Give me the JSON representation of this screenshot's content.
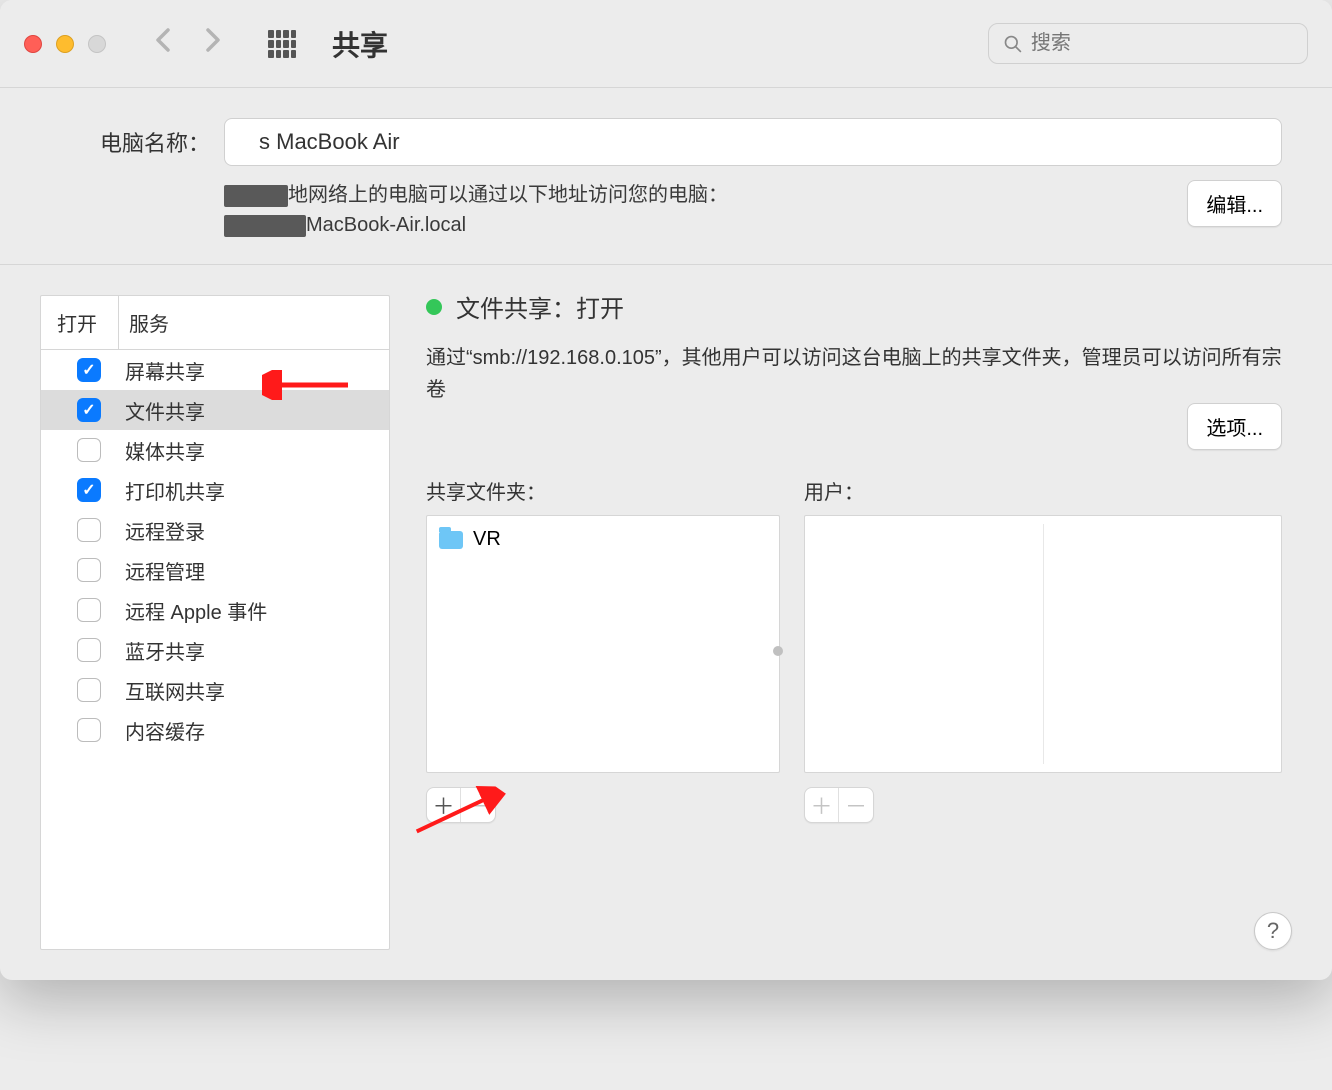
{
  "titlebar": {
    "title": "共享",
    "search_placeholder": "搜索"
  },
  "header": {
    "computer_name_label": "电脑名称：",
    "computer_name_value": "s MacBook Air",
    "desc_line1": "地网络上的电脑可以通过以下地址访问您的电脑：",
    "desc_line2": "MacBook-Air.local",
    "edit_button": "编辑..."
  },
  "services": {
    "col_on": "打开",
    "col_service": "服务",
    "items": [
      {
        "label": "屏幕共享",
        "checked": true,
        "selected": false
      },
      {
        "label": "文件共享",
        "checked": true,
        "selected": true
      },
      {
        "label": "媒体共享",
        "checked": false,
        "selected": false
      },
      {
        "label": "打印机共享",
        "checked": true,
        "selected": false
      },
      {
        "label": "远程登录",
        "checked": false,
        "selected": false
      },
      {
        "label": "远程管理",
        "checked": false,
        "selected": false
      },
      {
        "label": "远程 Apple 事件",
        "checked": false,
        "selected": false
      },
      {
        "label": "蓝牙共享",
        "checked": false,
        "selected": false
      },
      {
        "label": "互联网共享",
        "checked": false,
        "selected": false
      },
      {
        "label": "内容缓存",
        "checked": false,
        "selected": false
      }
    ]
  },
  "detail": {
    "status_title": "文件共享：打开",
    "description": "通过“smb://192.168.0.105”，其他用户可以访问这台电脑上的共享文件夹，管理员可以访问所有宗卷",
    "options_button": "选项...",
    "shared_folders_label": "共享文件夹：",
    "users_label": "用户：",
    "folders": [
      {
        "name": "VR"
      }
    ]
  },
  "help": "?"
}
